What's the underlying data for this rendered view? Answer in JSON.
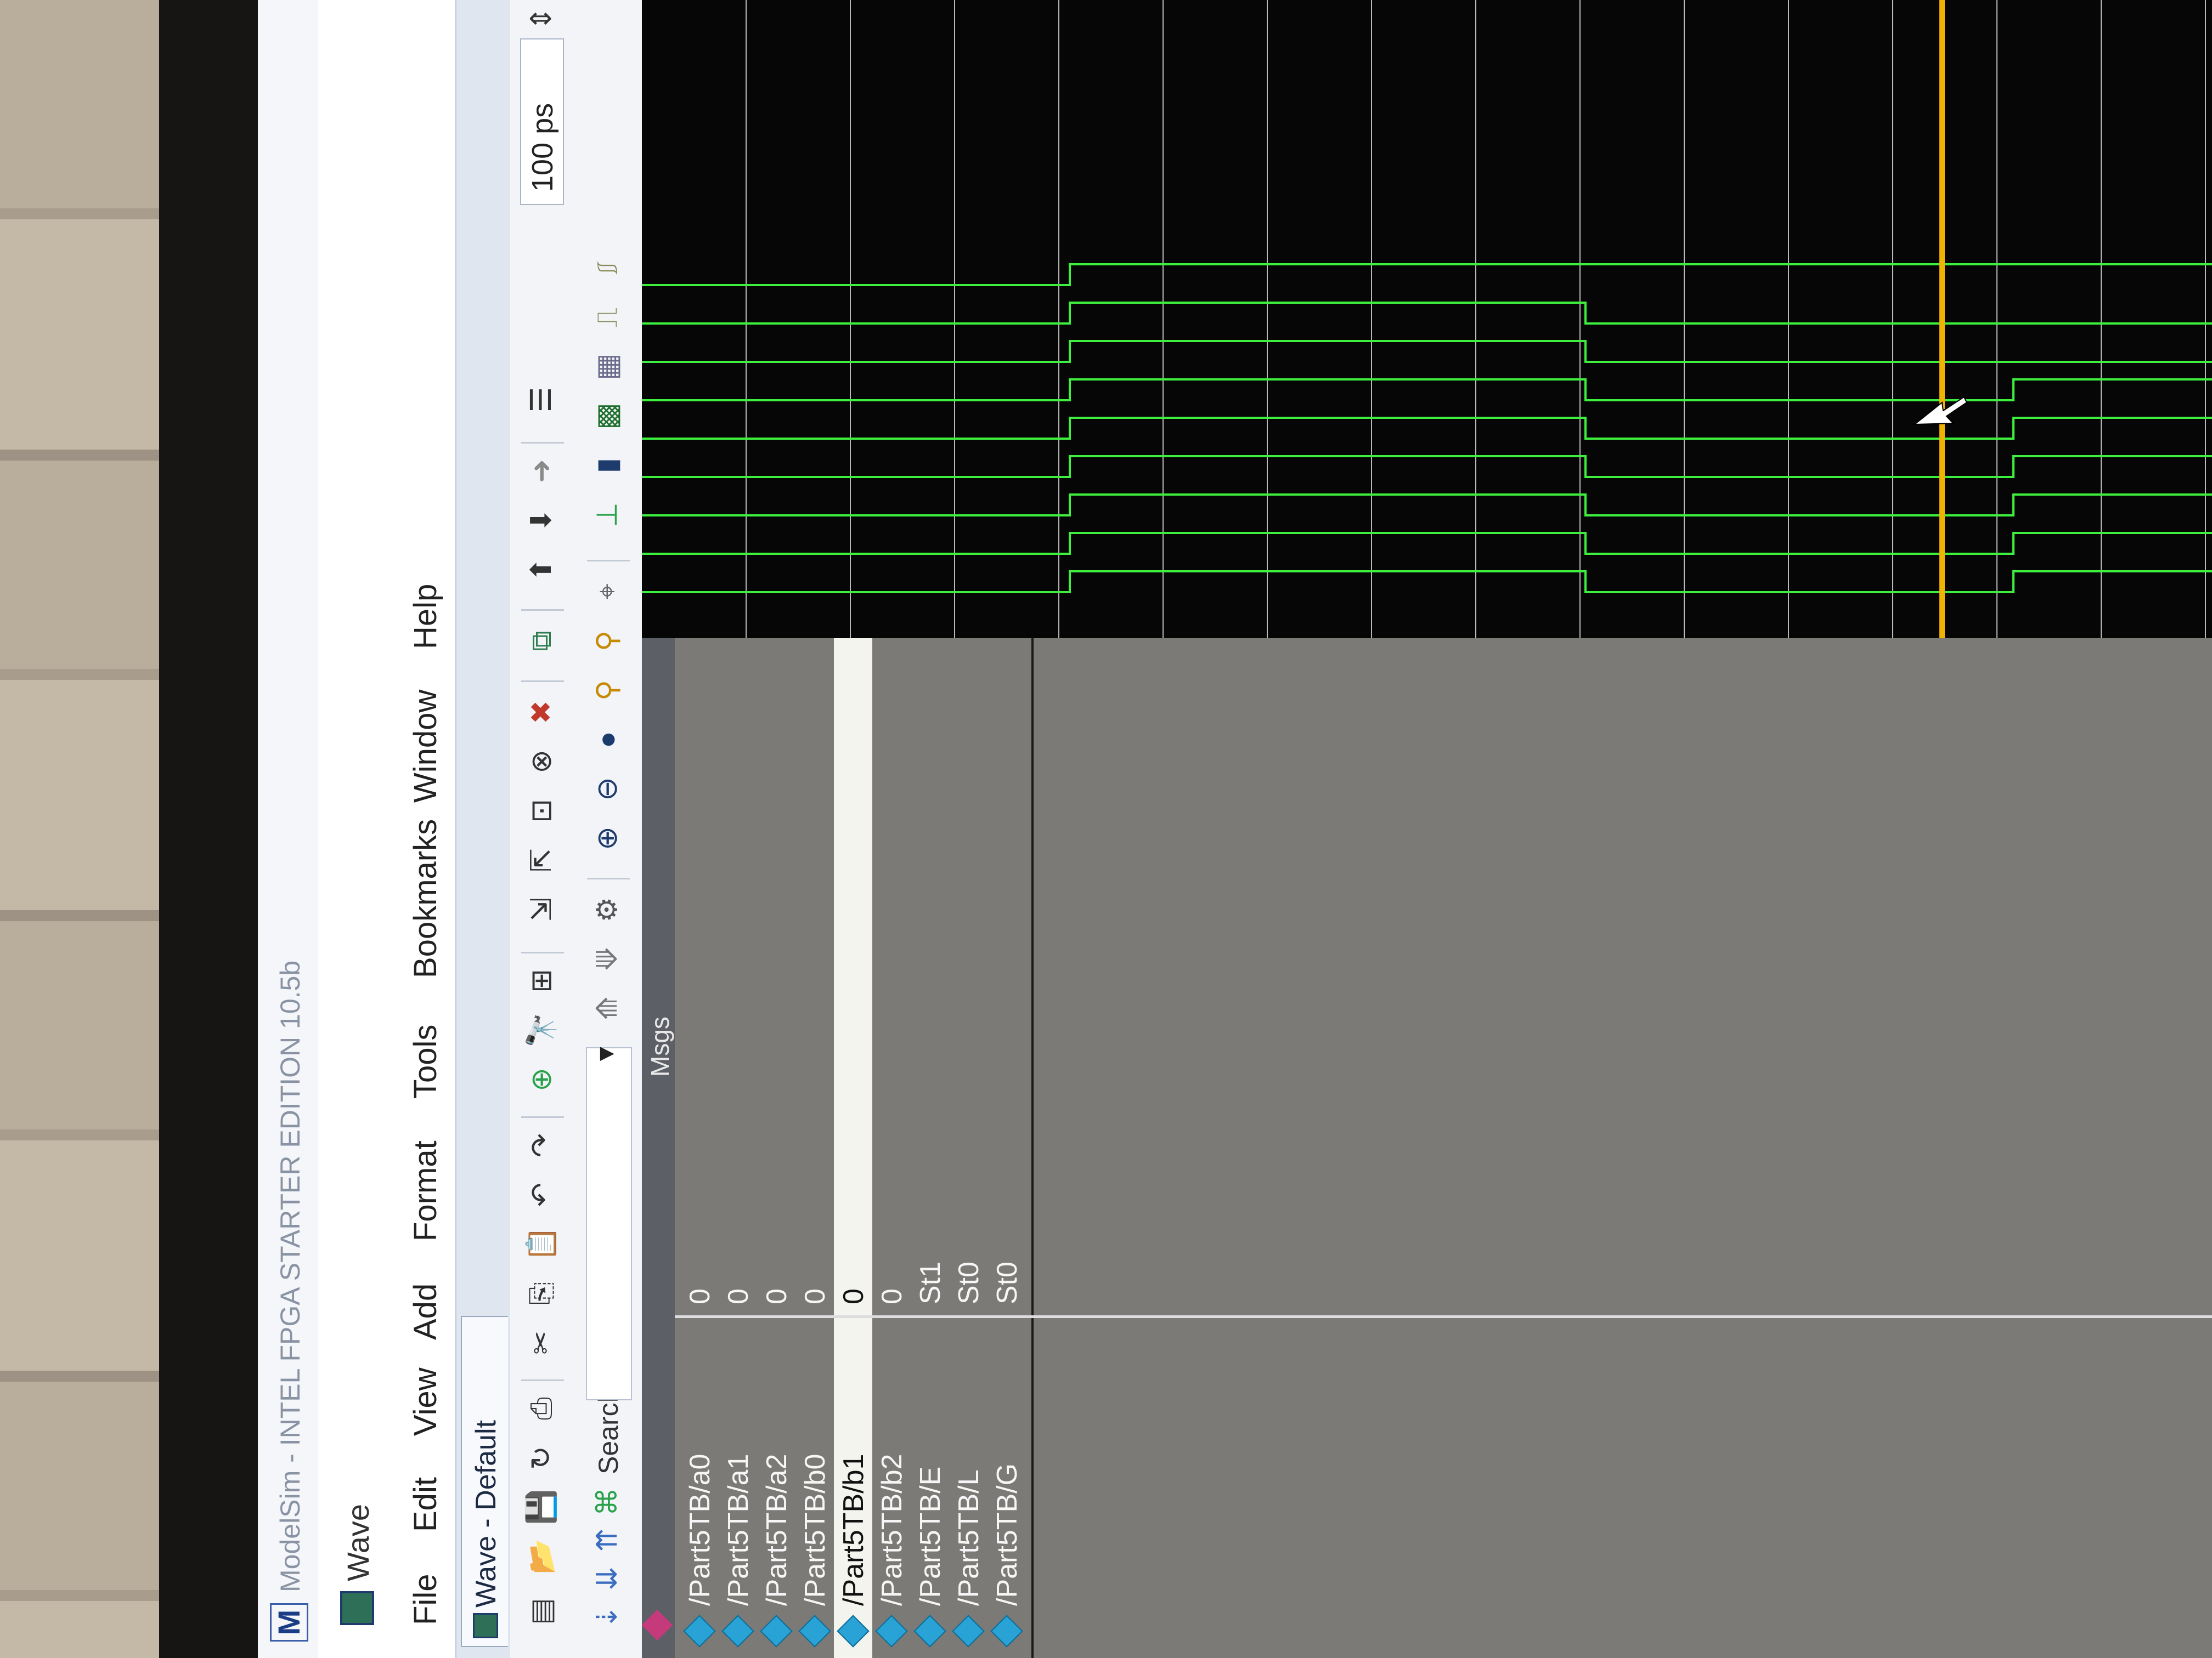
{
  "window": {
    "title": "ModelSim - INTEL FPGA STARTER EDITION 10.5b",
    "logo": "M"
  },
  "wave_window": {
    "label": "Wave"
  },
  "menu": [
    "File",
    "Edit",
    "View",
    "Add",
    "Format",
    "Tools",
    "Bookmarks",
    "Window",
    "Help"
  ],
  "tab": {
    "label": "Wave - Default"
  },
  "toolbar": {
    "search_label": "Search:",
    "time_value": "100",
    "time_unit": "ps"
  },
  "wave_header": {
    "msgs_label": "Msgs"
  },
  "signals": [
    {
      "name": "/Part5TB/a0",
      "value": "0",
      "selected": false
    },
    {
      "name": "/Part5TB/a1",
      "value": "0",
      "selected": false
    },
    {
      "name": "/Part5TB/a2",
      "value": "0",
      "selected": false
    },
    {
      "name": "/Part5TB/b0",
      "value": "0",
      "selected": false
    },
    {
      "name": "/Part5TB/b1",
      "value": "0",
      "selected": true
    },
    {
      "name": "/Part5TB/b2",
      "value": "0",
      "selected": false
    },
    {
      "name": "/Part5TB/E",
      "value": "St1",
      "selected": false
    },
    {
      "name": "/Part5TB/L",
      "value": "St0",
      "selected": false
    },
    {
      "name": "/Part5TB/G",
      "value": "St0",
      "selected": false
    }
  ],
  "colors": {
    "wave": "#3df03d",
    "cursor": "#f0b400",
    "grid": "#d9d9d9",
    "background": "#060606"
  }
}
